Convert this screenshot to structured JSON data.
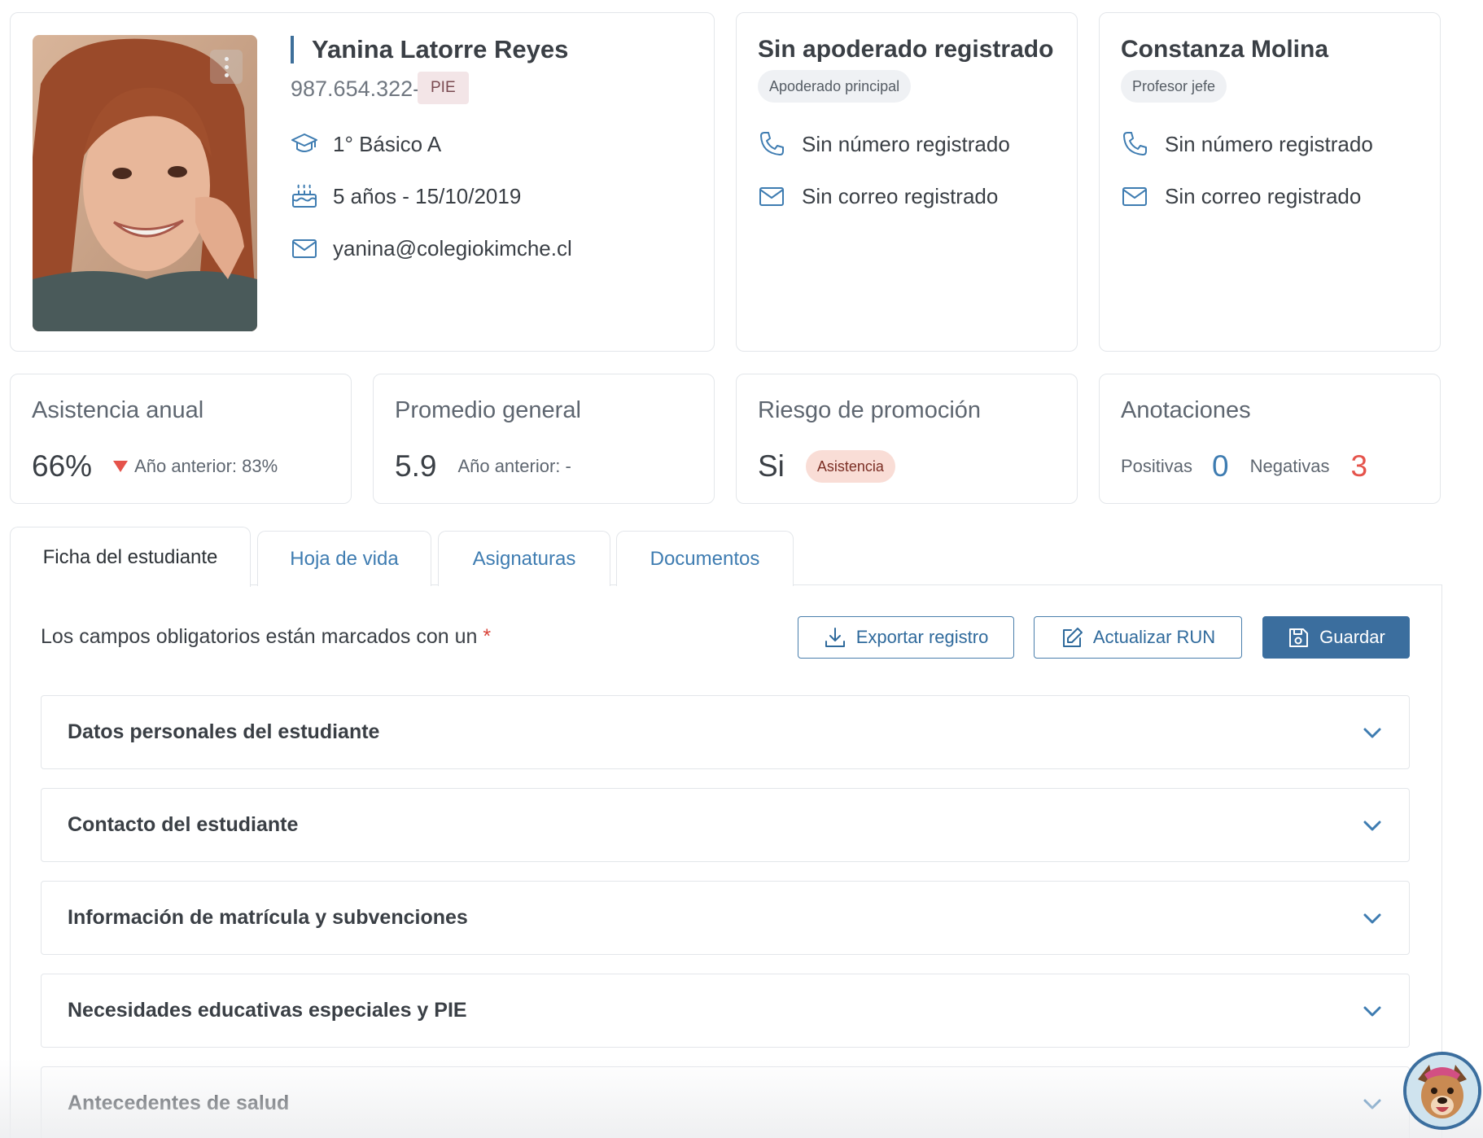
{
  "student": {
    "name": "Yanina Latorre Reyes",
    "rut": "987.654.322-K",
    "badge": "PIE",
    "course": "1° Básico A",
    "birth": "5 años - 15/10/2019",
    "email": "yanina@colegiokimche.cl"
  },
  "guardian": {
    "title": "Sin apoderado registrado",
    "role": "Apoderado principal",
    "phone": "Sin número registrado",
    "email": "Sin correo registrado"
  },
  "teacher": {
    "title": "Constanza Molina",
    "role": "Profesor jefe",
    "phone": "Sin número registrado",
    "email": "Sin correo registrado"
  },
  "stats": {
    "attendance": {
      "title": "Asistencia anual",
      "value": "66%",
      "previous": "Año anterior: 83%",
      "trend": "down"
    },
    "average": {
      "title": "Promedio general",
      "value": "5.9",
      "previous": "Año anterior: -"
    },
    "risk": {
      "title": "Riesgo de promoción",
      "value": "Si",
      "badge": "Asistencia"
    },
    "notes": {
      "title": "Anotaciones",
      "positive_label": "Positivas",
      "positive_value": "0",
      "negative_label": "Negativas",
      "negative_value": "3"
    }
  },
  "tabs": [
    {
      "label": "Ficha del estudiante",
      "active": true
    },
    {
      "label": "Hoja de vida",
      "active": false
    },
    {
      "label": "Asignaturas",
      "active": false
    },
    {
      "label": "Documentos",
      "active": false
    }
  ],
  "form": {
    "required_text": "Los campos obligatorios están marcados con un",
    "required_star": "*",
    "export_label": "Exportar registro",
    "update_run_label": "Actualizar RUN",
    "save_label": "Guardar"
  },
  "sections": [
    "Datos personales del estudiante",
    "Contacto del estudiante",
    "Información de matrícula y subvenciones",
    "Necesidades educativas especiales y PIE",
    "Antecedentes de salud"
  ],
  "colors": {
    "primary": "#3b6e9e",
    "link": "#3e7cb1",
    "negative": "#e5534b",
    "positive": "#3e7cb1"
  },
  "icons": [
    "more-vertical-icon",
    "graduation-cap-icon",
    "cake-icon",
    "mail-icon",
    "phone-icon",
    "download-icon",
    "edit-icon",
    "save-icon",
    "chevron-down-icon"
  ]
}
